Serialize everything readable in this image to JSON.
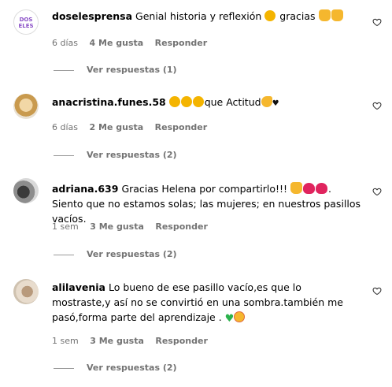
{
  "comments": [
    {
      "username": "doselesprensa",
      "text": "Genial historia y reflexión",
      "text_after": "gracias",
      "avatar_text": "DOS ELES",
      "age": "6 días",
      "likes": "4 Me gusta",
      "reply": "Responder",
      "view_replies": "Ver respuestas (1)"
    },
    {
      "username": "anacristina.funes.58",
      "text": "que Actitud",
      "age": "6 días",
      "likes": "2 Me gusta",
      "reply": "Responder",
      "view_replies": "Ver respuestas (2)"
    },
    {
      "username": "adriana.639",
      "text": "Gracias Helena por compartirlo!!!",
      "text_after": ". Siento que no estamos solas; las mujeres; en nuestros pasillos vacíos.",
      "age": "1 sem",
      "likes": "3 Me gusta",
      "reply": "Responder",
      "view_replies": "Ver respuestas (2)"
    },
    {
      "username": "alilavenia",
      "text": "Lo bueno de ese pasillo vacío,es que lo mostraste,y así no se convirtió en una sombra.también me pasó,forma parte del aprendizaje .",
      "age": "1 sem",
      "likes": "3 Me gusta",
      "reply": "Responder",
      "view_replies": "Ver respuestas (2)"
    }
  ],
  "colors": {
    "meta": "#737373",
    "avatar_logo_text": "#8a4fc7"
  }
}
